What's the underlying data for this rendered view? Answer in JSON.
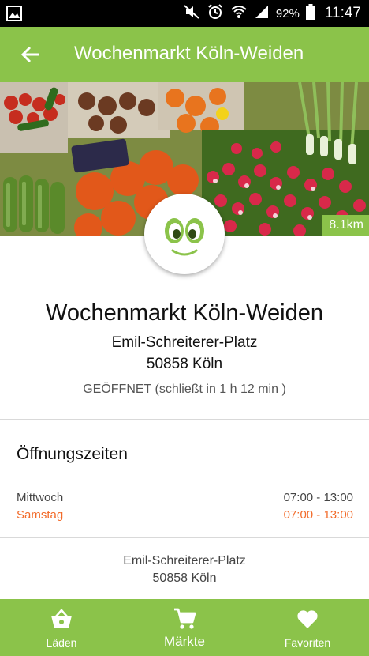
{
  "status_bar": {
    "battery": "92%",
    "time": "11:47"
  },
  "app_bar": {
    "title": "Wochenmarkt Köln-Weiden"
  },
  "hero": {
    "distance": "8.1km"
  },
  "market": {
    "name": "Wochenmarkt Köln-Weiden",
    "street": "Emil-Schreiterer-Platz",
    "city": "50858 Köln",
    "status": "GEÖFFNET (schließt in 1 h 12 min )"
  },
  "hours": {
    "title": "Öffnungszeiten",
    "rows": [
      {
        "day": "Mittwoch",
        "time": "07:00 - 13:00",
        "today": false
      },
      {
        "day": "Samstag",
        "time": "07:00 - 13:00",
        "today": true
      }
    ]
  },
  "footer_address": {
    "street": "Emil-Schreiterer-Platz",
    "city": "50858 Köln"
  },
  "bottom_nav": {
    "items": [
      {
        "label": "Läden",
        "icon": "basket-icon"
      },
      {
        "label": "Märkte",
        "icon": "cart-icon",
        "active": true
      },
      {
        "label": "Favoriten",
        "icon": "heart-icon"
      }
    ]
  },
  "colors": {
    "brand_green": "#8bc34a",
    "today_orange": "#f26b2a"
  }
}
